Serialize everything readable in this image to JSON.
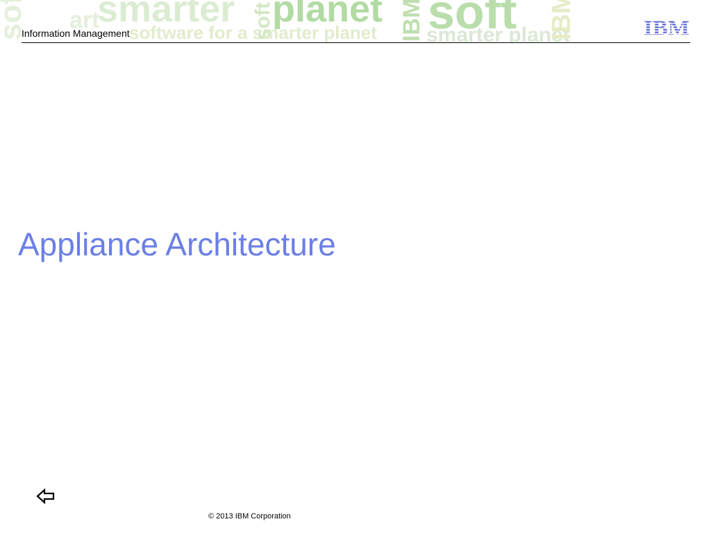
{
  "header": {
    "title": "Information Management",
    "logo_text": "IBM",
    "rule_color": "#000000"
  },
  "banner": {
    "watermark_words": [
      "smarter",
      "planet",
      "software for a smarter planet",
      "soft",
      "smarter planet",
      "IBM",
      "soft",
      "IBM"
    ],
    "colors": {
      "light_green": "#d7eacf",
      "mid_green": "#a9d69a",
      "yellow_green": "#e6ecb6"
    }
  },
  "slide": {
    "title": "Appliance Architecture",
    "title_color": "#6b7fe6"
  },
  "navigation": {
    "back_icon": "back-arrow-icon"
  },
  "footer": {
    "copyright": "© 2013 IBM Corporation"
  },
  "brand": {
    "logo_color": "#5a67d8"
  }
}
